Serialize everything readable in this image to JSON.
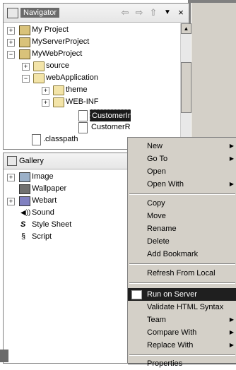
{
  "navigator": {
    "title": "Navigator",
    "toolbar_icons": [
      "back-arrow-icon",
      "forward-arrow-icon",
      "up-arrow-icon",
      "view-menu-icon",
      "close-icon"
    ],
    "tree": [
      {
        "label": "My Project",
        "type": "project",
        "expand": "+"
      },
      {
        "label": "MyServerProject",
        "type": "project",
        "expand": "+"
      },
      {
        "label": "MyWebProject",
        "type": "project",
        "expand": "−"
      },
      {
        "label": "source",
        "type": "folder",
        "expand": "+"
      },
      {
        "label": "webApplication",
        "type": "folder",
        "expand": "−"
      },
      {
        "label": "theme",
        "type": "folder",
        "expand": "+"
      },
      {
        "label": "WEB-INF",
        "type": "folder",
        "expand": "+"
      },
      {
        "label": "CustomerInputForm.html",
        "type": "file",
        "selected": true
      },
      {
        "label": "CustomerResults.html",
        "type": "file"
      },
      {
        "label": ".classpath",
        "type": "file"
      }
    ]
  },
  "gallery": {
    "title": "Gallery",
    "items": [
      {
        "label": "Image",
        "expand": "+"
      },
      {
        "label": "Wallpaper",
        "expand": ""
      },
      {
        "label": "Webart",
        "expand": "+"
      },
      {
        "label": "Sound",
        "expand": ""
      },
      {
        "label": "Style Sheet",
        "expand": ""
      },
      {
        "label": "Script",
        "expand": ""
      }
    ]
  },
  "context_menu": {
    "items": [
      {
        "label": "New",
        "submenu": true
      },
      {
        "label": "Go To",
        "submenu": true
      },
      {
        "label": "Open",
        "submenu": false
      },
      {
        "label": "Open With",
        "submenu": true
      },
      {
        "label": "Copy",
        "submenu": false
      },
      {
        "label": "Move",
        "submenu": false
      },
      {
        "label": "Rename",
        "submenu": false
      },
      {
        "label": "Delete",
        "submenu": false
      },
      {
        "label": "Add Bookmark",
        "submenu": false
      },
      {
        "label": "Refresh From Local",
        "submenu": false
      },
      {
        "label": "Run on Server",
        "submenu": false,
        "highlighted": true
      },
      {
        "label": "Validate HTML Syntax",
        "submenu": false
      },
      {
        "label": "Team",
        "submenu": true
      },
      {
        "label": "Compare With",
        "submenu": true
      },
      {
        "label": "Replace With",
        "submenu": true
      },
      {
        "label": "Properties",
        "submenu": false
      }
    ]
  }
}
